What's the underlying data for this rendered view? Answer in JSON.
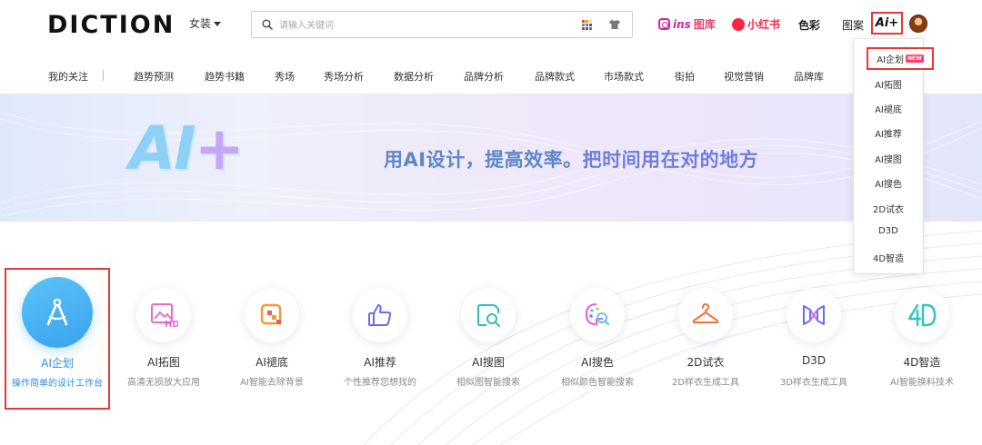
{
  "header": {
    "logo": "DICTION",
    "category": "女装",
    "search_placeholder": "请输入关键词",
    "ins_prefix": "ins",
    "ins_suffix": "图库",
    "xiaohongshu": "小红书",
    "color": "色彩",
    "pattern": "图案",
    "ai_button": "Ai+"
  },
  "nav": {
    "items": [
      "我的关注",
      "趋势预测",
      "趋势书籍",
      "秀场",
      "秀场分析",
      "数据分析",
      "品牌分析",
      "品牌款式",
      "市场款式",
      "街拍",
      "视觉营销",
      "品牌库"
    ]
  },
  "banner": {
    "ai_text": "AI",
    "plus_text": "+",
    "slogan_bold": "用AI设计，提高效率。",
    "slogan_rest": "把时间用在对的地方"
  },
  "cards": [
    {
      "name": "AI企划",
      "desc": "操作简单的设计工作台",
      "icon": "compass-icon"
    },
    {
      "name": "AI拓图",
      "desc": "高清无损放大应用",
      "icon": "hd-image-icon"
    },
    {
      "name": "AI褪底",
      "desc": "AI智能去除背景",
      "icon": "remove-bg-icon"
    },
    {
      "name": "AI推荐",
      "desc": "个性推荐您想找的",
      "icon": "thumbs-up-icon"
    },
    {
      "name": "AI搜图",
      "desc": "相似图智能搜索",
      "icon": "image-search-icon"
    },
    {
      "name": "AI搜色",
      "desc": "相似颜色智能搜索",
      "icon": "palette-search-icon"
    },
    {
      "name": "2D试衣",
      "desc": "2D样衣生成工具",
      "icon": "hanger-icon"
    },
    {
      "name": "D3D",
      "desc": "3D样衣生成工具",
      "icon": "d3d-icon"
    },
    {
      "name": "4D智造",
      "desc": "AI智能换料技术",
      "icon": "4d-icon"
    }
  ],
  "dropdown": {
    "items": [
      "AI企划",
      "AI拓图",
      "AI褪底",
      "AI推荐",
      "AI搜图",
      "AI搜色",
      "2D试衣",
      "D3D",
      "4D智造"
    ],
    "new_badge": "NEW"
  },
  "colors": {
    "accent_blue": "#3aa2ee",
    "highlight_red": "#e53935",
    "ins_pink": "#d6249f",
    "xhs_red": "#ff2442"
  }
}
